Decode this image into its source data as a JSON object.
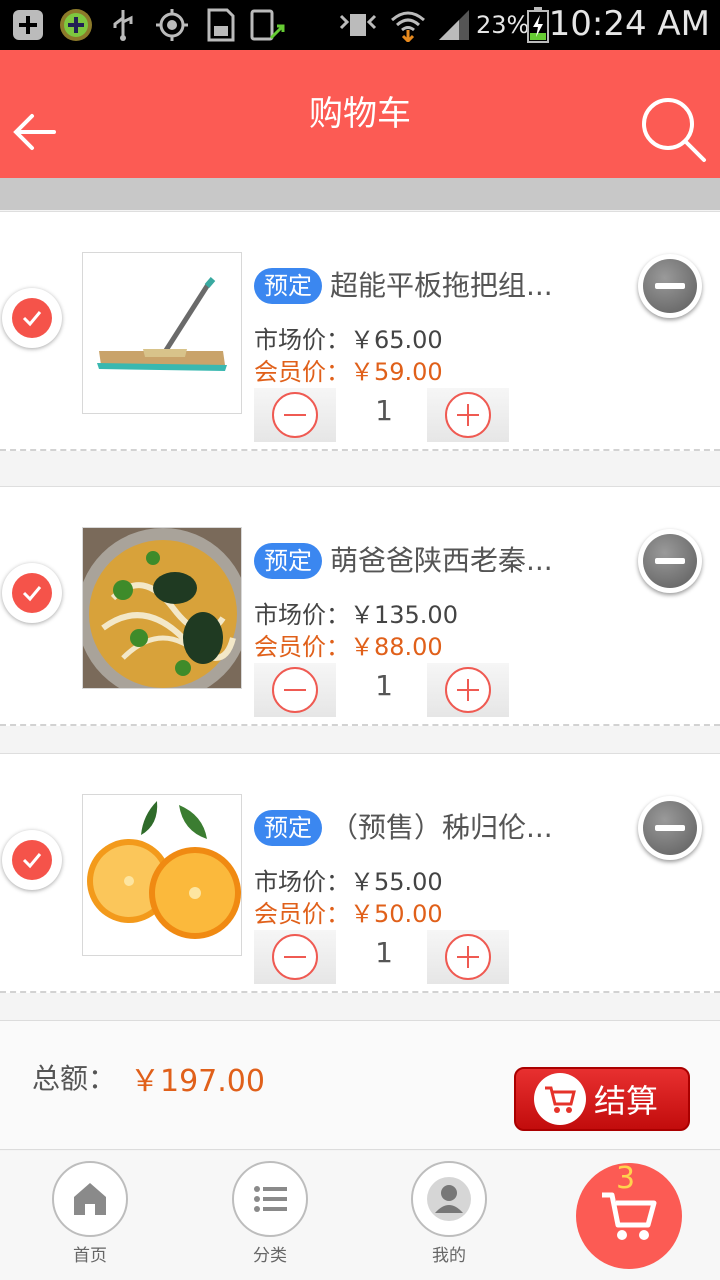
{
  "status_bar": {
    "battery": "23%",
    "time": "10:24 AM"
  },
  "header": {
    "title": "购物车",
    "back_icon": "back-arrow-icon",
    "search_icon": "search-icon"
  },
  "items": [
    {
      "tag": "预定",
      "name": "超能平板拖把组...",
      "market_price": "市场价：￥65.00",
      "member_price": "会员价：￥59.00",
      "quantity": "1",
      "image": "mop-image"
    },
    {
      "tag": "预定",
      "name": "萌爸爸陕西老秦...",
      "market_price": "市场价：￥135.00",
      "member_price": "会员价：￥88.00",
      "quantity": "1",
      "image": "noodle-image"
    },
    {
      "tag": "预定",
      "name": "（预售）秭归伦...",
      "market_price": "市场价：￥55.00",
      "member_price": "会员价：￥50.00",
      "quantity": "1",
      "image": "orange-image"
    }
  ],
  "summary": {
    "total_label": "总额：",
    "total_value": "￥197.00",
    "checkout_label": "结算"
  },
  "nav": {
    "home": "首页",
    "category": "分类",
    "mine": "我的",
    "cart_count": "3"
  },
  "colors": {
    "brand": "#fc5b54",
    "tag": "#3b87f0",
    "price_accent": "#e0601a"
  }
}
